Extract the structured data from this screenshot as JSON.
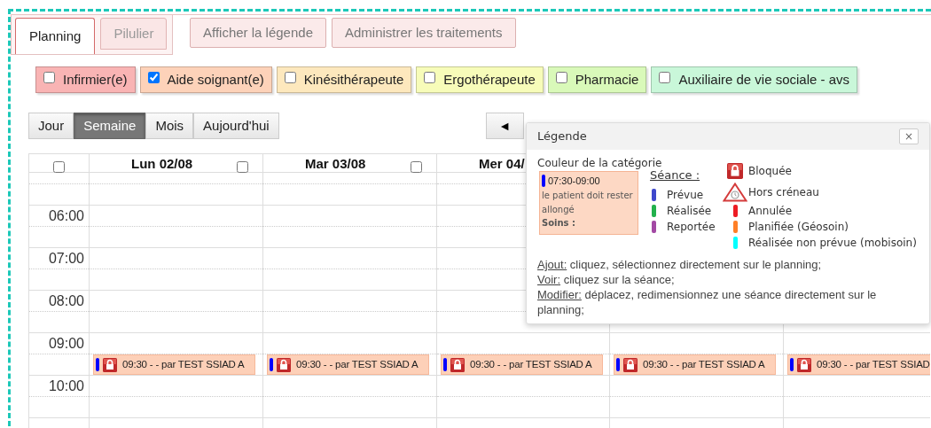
{
  "tabs": [
    {
      "label": "Planning",
      "selected": true
    },
    {
      "label": "Pilulier",
      "selected": false
    }
  ],
  "actions": [
    "Afficher la légende",
    "Administrer les traitements"
  ],
  "categories": [
    {
      "label": "Infirmier(e)",
      "checked": false,
      "color": "#f9b4b4"
    },
    {
      "label": "Aide soignant(e)",
      "checked": true,
      "color": "#fdd2b9"
    },
    {
      "label": "Kinésithérapeute",
      "checked": false,
      "color": "#fde8bd"
    },
    {
      "label": "Ergothérapeute",
      "checked": false,
      "color": "#f7fcb9"
    },
    {
      "label": "Pharmacie",
      "checked": false,
      "color": "#d9f9b9"
    },
    {
      "label": "Auxiliaire de vie sociale - avs",
      "checked": false,
      "color": "#c9f7d9"
    }
  ],
  "views": [
    {
      "label": "Jour",
      "selected": false
    },
    {
      "label": "Semaine",
      "selected": true
    },
    {
      "label": "Mois",
      "selected": false
    },
    {
      "label": "Aujourd'hui",
      "selected": false
    }
  ],
  "prev_button": "◄",
  "grid": {
    "select_all_checked": false,
    "days": [
      {
        "label": "Lun 02/08",
        "checked": false,
        "events": [
          {
            "text": "09:30 - - par TEST SSIAD A",
            "color": "#0000ff",
            "blocked": true
          }
        ]
      },
      {
        "label": "Mar 03/08",
        "checked": false,
        "events": [
          {
            "text": "09:30 - - par TEST SSIAD A",
            "color": "#0000ff",
            "blocked": true
          }
        ]
      },
      {
        "label": "Mer 04/",
        "events": [
          {
            "text": "09:30 - - par TEST SSIAD A",
            "color": "#0000ff",
            "blocked": true
          }
        ]
      },
      {
        "events": [
          {
            "text": "09:30 - - par TEST SSIAD A",
            "color": "#0000ff",
            "blocked": true
          }
        ]
      },
      {
        "events": [
          {
            "text": "09:30 - - par TEST SSIAD",
            "color": "#0000ff",
            "blocked": true
          }
        ]
      }
    ],
    "hours": [
      "06:00",
      "07:00",
      "08:00",
      "09:00",
      "10:00"
    ]
  },
  "legend": {
    "title": "Légende",
    "close": "×",
    "category_label": "Couleur de la catégorie",
    "sample": {
      "time": "07:30-09:00",
      "note": "le patient doit rester allongé",
      "care": "Soins :",
      "color": "#0000ff"
    },
    "session_label": "Séance :",
    "statuses": [
      {
        "label": "Prévue",
        "color": "#3f48cc"
      },
      {
        "label": "Réalisée",
        "color": "#22b14c"
      },
      {
        "label": "Reportée",
        "color": "#a349a4"
      }
    ],
    "markers": [
      {
        "kind": "lock",
        "label": "Bloquée"
      },
      {
        "kind": "warning",
        "label": "Hors créneau"
      },
      {
        "kind": "bar",
        "label": "Annulée",
        "color": "#ed1c24"
      },
      {
        "kind": "bar",
        "label": "Planifiée (Géosoin)",
        "color": "#ff7f27"
      },
      {
        "kind": "bar",
        "label": "Réalisée non prévue (mobisoin)",
        "color": "#00ffff"
      }
    ],
    "help": [
      {
        "term": "Ajout:",
        "text": " cliquez, sélectionnez directement sur le planning;"
      },
      {
        "term": "Voir:",
        "text": " cliquez sur la séance;"
      },
      {
        "term": "Modifier:",
        "text": " déplacez, redimensionnez une séance directement sur le planning;"
      }
    ]
  }
}
